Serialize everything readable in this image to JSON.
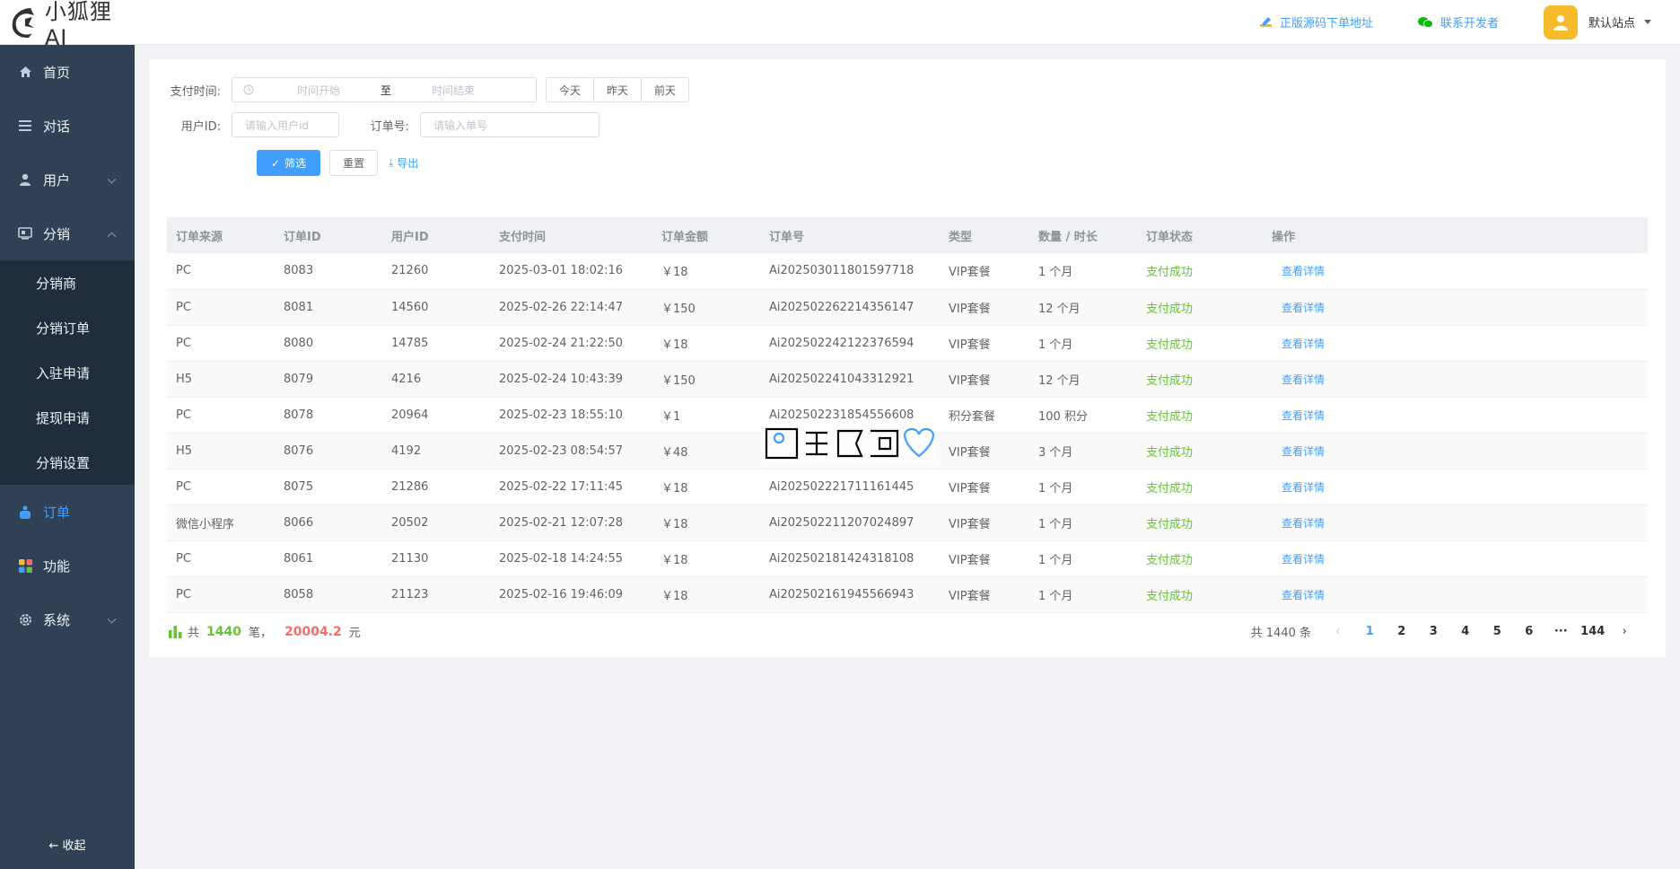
{
  "brand": {
    "name": "小狐狸AI"
  },
  "header": {
    "source_link": "正版源码下单地址",
    "contact_link": "联系开发者",
    "site_label": "默认站点"
  },
  "sidebar": {
    "items": [
      {
        "label": "首页",
        "icon": "home-icon"
      },
      {
        "label": "对话",
        "icon": "list-icon"
      },
      {
        "label": "用户",
        "icon": "user-icon"
      },
      {
        "label": "分销",
        "icon": "distribution-icon"
      },
      {
        "label": "订单",
        "icon": "order-icon"
      },
      {
        "label": "功能",
        "icon": "apps-icon"
      },
      {
        "label": "系统",
        "icon": "settings-icon"
      }
    ],
    "distribution_sub": [
      {
        "label": "分销商"
      },
      {
        "label": "分销订单"
      },
      {
        "label": "入驻申请"
      },
      {
        "label": "提现申请"
      },
      {
        "label": "分销设置"
      }
    ],
    "collapse_label": "收起"
  },
  "filters": {
    "pay_time_label": "支付时间:",
    "start_placeholder": "时间开始",
    "range_sep": "至",
    "end_placeholder": "时间结束",
    "quick": [
      "今天",
      "昨天",
      "前天"
    ],
    "user_id_label": "用户ID:",
    "user_id_placeholder": "请输入用户id",
    "order_no_label": "订单号:",
    "order_no_placeholder": "请输入单号",
    "filter_btn": "筛选",
    "reset_btn": "重置",
    "export_btn": "导出"
  },
  "table": {
    "columns": [
      "订单来源",
      "订单ID",
      "用户ID",
      "支付时间",
      "订单金额",
      "订单号",
      "类型",
      "数量 / 时长",
      "订单状态",
      "操作"
    ],
    "rows": [
      [
        "PC",
        "8083",
        "21260",
        "2025-03-01 18:02:16",
        "￥18",
        "Ai202503011801597718",
        "VIP套餐",
        "1 个月",
        "支付成功",
        "查看详情"
      ],
      [
        "PC",
        "8081",
        "14560",
        "2025-02-26 22:14:47",
        "￥150",
        "Ai202502262214356147",
        "VIP套餐",
        "12 个月",
        "支付成功",
        "查看详情"
      ],
      [
        "PC",
        "8080",
        "14785",
        "2025-02-24 21:22:50",
        "￥18",
        "Ai202502242122376594",
        "VIP套餐",
        "1 个月",
        "支付成功",
        "查看详情"
      ],
      [
        "H5",
        "8079",
        "4216",
        "2025-02-24 10:43:39",
        "￥150",
        "Ai202502241043312921",
        "VIP套餐",
        "12 个月",
        "支付成功",
        "查看详情"
      ],
      [
        "PC",
        "8078",
        "20964",
        "2025-02-23 18:55:10",
        "￥1",
        "Ai202502231854556608",
        "积分套餐",
        "100 积分",
        "支付成功",
        "查看详情"
      ],
      [
        "H5",
        "8076",
        "4192",
        "2025-02-23 08:54:57",
        "￥48",
        "",
        "VIP套餐",
        "3 个月",
        "支付成功",
        "查看详情"
      ],
      [
        "PC",
        "8075",
        "21286",
        "2025-02-22 17:11:45",
        "￥18",
        "Ai202502221711161445",
        "VIP套餐",
        "1 个月",
        "支付成功",
        "查看详情"
      ],
      [
        "微信小程序",
        "8066",
        "20502",
        "2025-02-21 12:07:28",
        "￥18",
        "Ai202502211207024897",
        "VIP套餐",
        "1 个月",
        "支付成功",
        "查看详情"
      ],
      [
        "PC",
        "8061",
        "21130",
        "2025-02-18 14:24:55",
        "￥18",
        "Ai202502181424318108",
        "VIP套餐",
        "1 个月",
        "支付成功",
        "查看详情"
      ],
      [
        "PC",
        "8058",
        "21123",
        "2025-02-16 19:46:09",
        "￥18",
        "Ai202502161945566943",
        "VIP套餐",
        "1 个月",
        "支付成功",
        "查看详情"
      ]
    ]
  },
  "summary": {
    "prefix": "共",
    "count": "1440",
    "unit1": "笔，",
    "amount": "20004.2",
    "unit2": "元"
  },
  "pagination": {
    "total_label": "共 1440 条",
    "pages": [
      "1",
      "2",
      "3",
      "4",
      "5",
      "6",
      "···",
      "144"
    ],
    "current": "1"
  },
  "colors": {
    "primary": "#409eff",
    "success": "#67c23a",
    "danger": "#f56c6c",
    "sidebar_bg": "#304156",
    "submenu_bg": "#1f2d3d"
  }
}
